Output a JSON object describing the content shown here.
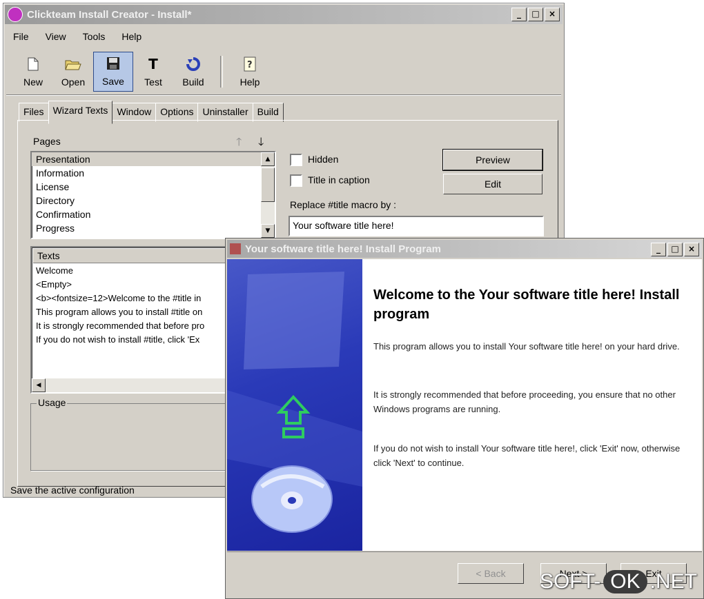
{
  "main_window": {
    "title": "Clickteam Install Creator - Install*",
    "window_buttons": [
      "_",
      "□",
      "×"
    ],
    "menu": [
      "File",
      "View",
      "Tools",
      "Help"
    ],
    "toolbar": [
      {
        "label": "New",
        "icon": "new-document-icon"
      },
      {
        "label": "Open",
        "icon": "open-folder-icon"
      },
      {
        "label": "Save",
        "icon": "save-disk-icon"
      },
      {
        "label": "Test",
        "icon": "test-T-icon"
      },
      {
        "label": "Build",
        "icon": "build-arrow-icon"
      },
      {
        "label": "Help",
        "icon": "help-question-icon"
      }
    ],
    "tabs": [
      "Files",
      "Wizard Texts",
      "Window",
      "Options",
      "Uninstaller",
      "Build"
    ],
    "selected_tab": "Wizard Texts",
    "pages_label": "Pages",
    "pages": [
      "Presentation",
      "Information",
      "License",
      "Directory",
      "Confirmation",
      "Progress"
    ],
    "hidden_label": "Hidden",
    "title_caption_label": "Title in caption",
    "preview_button": "Preview",
    "edit_button": "Edit",
    "replace_label": "Replace #title macro by :",
    "replace_value": "Your software title here!",
    "texts_header": "Texts",
    "texts": [
      "Welcome",
      "<Empty>",
      "<b><fontsize=12>Welcome to the #title in",
      "This program allows you to install #title on",
      "It is strongly recommended that before pro",
      "If you do not wish to install #title, click 'Ex"
    ],
    "usage_label": "Usage",
    "status": "Save the active configuration"
  },
  "installer": {
    "title": "Your software title here! Install Program",
    "window_buttons": [
      "_",
      "□",
      "×"
    ],
    "welcome_title": "Welcome to the Your software title here! Install program",
    "paragraphs": [
      "This program allows you to install Your software title here! on your hard drive.",
      "It is strongly recommended that before proceeding, you ensure that no other Windows programs are running.",
      "If you do not wish to install Your software title here!, click 'Exit' now, otherwise click 'Next' to continue."
    ],
    "back_button": "< Back",
    "next_button": "Next >",
    "exit_button": "Exit"
  },
  "watermark": {
    "left": "SOFT-",
    "middle": "OK",
    "right": ".NET"
  }
}
